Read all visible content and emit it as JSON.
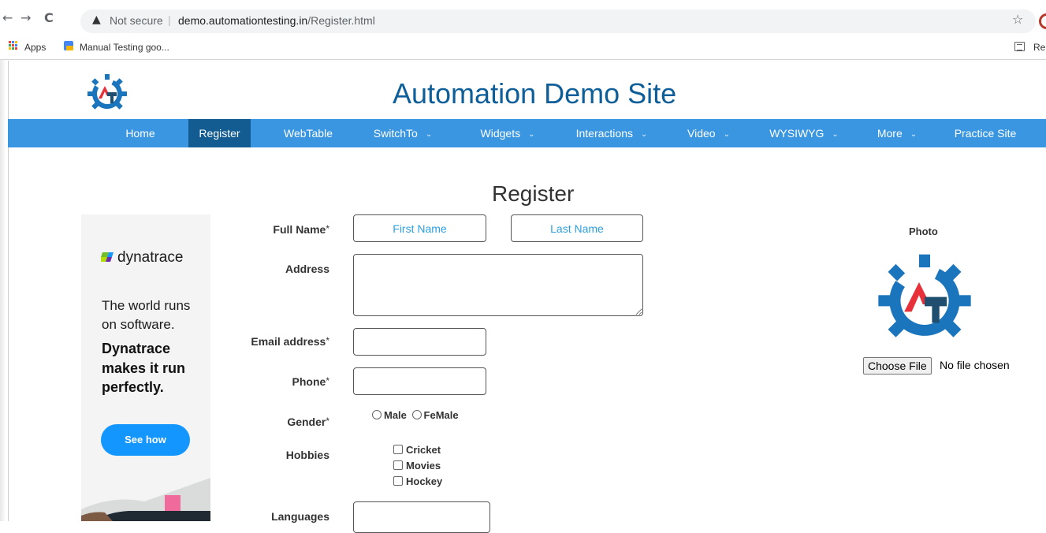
{
  "browser": {
    "back_icon": "←",
    "forward_icon": "→",
    "reload_icon": "C",
    "warning_icon": "▲",
    "not_secure": "Not secure",
    "separator": "|",
    "url_host": "demo.automationtesting.in",
    "url_path": "/Register.html",
    "star_icon": "☆"
  },
  "bookmarks": {
    "apps": "Apps",
    "manual_testing": "Manual Testing goo...",
    "reading_list": "Re"
  },
  "header": {
    "title": "Automation Demo Site",
    "logo_colors": {
      "gear": "#1b75bc",
      "a": "#e8303a",
      "t": "#1f4e6e"
    }
  },
  "nav": {
    "items": [
      {
        "label": "Home",
        "has_menu": false,
        "active": false
      },
      {
        "label": "Register",
        "has_menu": false,
        "active": true
      },
      {
        "label": "WebTable",
        "has_menu": false,
        "active": false
      },
      {
        "label": "SwitchTo",
        "has_menu": true,
        "active": false
      },
      {
        "label": "Widgets",
        "has_menu": true,
        "active": false
      },
      {
        "label": "Interactions",
        "has_menu": true,
        "active": false
      },
      {
        "label": "Video",
        "has_menu": true,
        "active": false
      },
      {
        "label": "WYSIWYG",
        "has_menu": true,
        "active": false
      },
      {
        "label": "More",
        "has_menu": true,
        "active": false
      },
      {
        "label": "Practice Site",
        "has_menu": false,
        "active": false
      }
    ],
    "chevron": "⌄",
    "bar_color": "#3a96e0",
    "active_color": "#125c92"
  },
  "ad": {
    "brand": "dynatrace",
    "line1": "The world runs",
    "line2": "on software.",
    "bold1": "Dynatrace",
    "bold2": "makes it run",
    "bold3": "perfectly.",
    "cta": "See how",
    "cta_color": "#1496ff"
  },
  "form": {
    "heading": "Register",
    "required_mark": "*",
    "full_name_label": "Full Name",
    "first_name_placeholder": "First Name",
    "last_name_placeholder": "Last Name",
    "address_label": "Address",
    "email_label": "Email address",
    "phone_label": "Phone",
    "gender_label": "Gender",
    "gender_options": [
      "Male",
      "FeMale"
    ],
    "hobbies_label": "Hobbies",
    "hobbies": [
      "Cricket",
      "Movies",
      "Hockey"
    ],
    "languages_label": "Languages"
  },
  "photo": {
    "label": "Photo",
    "choose_file": "Choose File",
    "no_file": "No file chosen"
  }
}
